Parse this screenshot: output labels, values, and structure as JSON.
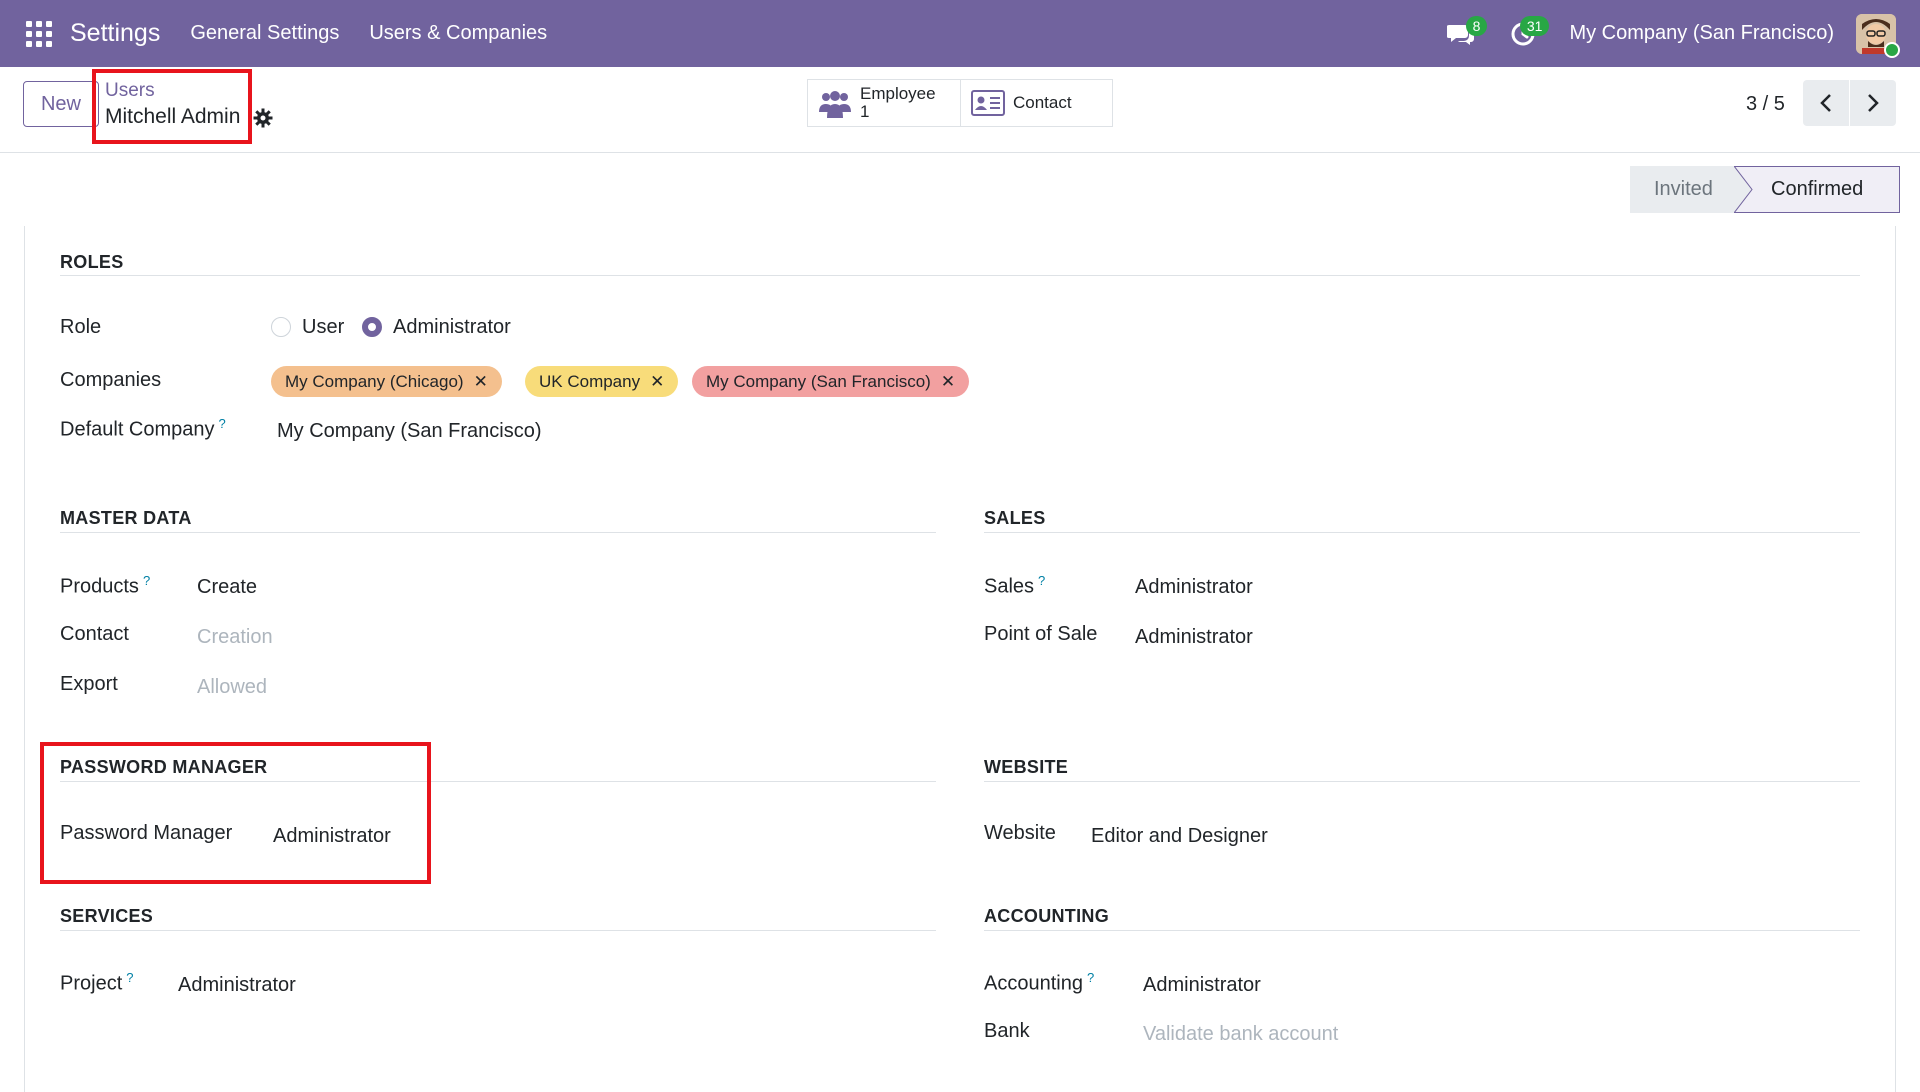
{
  "navbar": {
    "app_name": "Settings",
    "menus": [
      "General Settings",
      "Users & Companies"
    ],
    "messages_badge": "8",
    "activities_badge": "31",
    "company": "My Company (San Francisco)"
  },
  "control": {
    "new_label": "New",
    "breadcrumb_parent": "Users",
    "breadcrumb_current": "Mitchell Admin",
    "employee_label": "Employee",
    "employee_count": "1",
    "contact_label": "Contact",
    "pager": "3 / 5"
  },
  "status": {
    "invited": "Invited",
    "confirmed": "Confirmed"
  },
  "roles": {
    "title": "ROLES",
    "role_label": "Role",
    "role_options": [
      "User",
      "Administrator"
    ],
    "role_selected": "Administrator",
    "companies_label": "Companies",
    "companies": [
      "My Company (Chicago)",
      "UK Company",
      "My Company (San Francisco)"
    ],
    "default_company_label": "Default Company",
    "default_company_value": "My Company (San Francisco)",
    "help_mark": "?"
  },
  "master_data": {
    "title": "MASTER DATA",
    "products_label": "Products",
    "products_value": "Create",
    "contact_label": "Contact",
    "contact_value": "Creation",
    "export_label": "Export",
    "export_value": "Allowed"
  },
  "sales": {
    "title": "SALES",
    "sales_label": "Sales",
    "sales_value": "Administrator",
    "pos_label": "Point of Sale",
    "pos_value": "Administrator"
  },
  "password_manager": {
    "title": "PASSWORD MANAGER",
    "label": "Password Manager",
    "value": "Administrator"
  },
  "website": {
    "title": "WEBSITE",
    "label": "Website",
    "value": "Editor and Designer"
  },
  "services": {
    "title": "SERVICES",
    "project_label": "Project",
    "project_value": "Administrator"
  },
  "accounting": {
    "title": "ACCOUNTING",
    "accounting_label": "Accounting",
    "accounting_value": "Administrator",
    "bank_label": "Bank",
    "bank_value": "Validate bank account"
  },
  "colors": {
    "brand": "#71639e",
    "highlight": "#e8141c",
    "badge": "#28a745"
  }
}
